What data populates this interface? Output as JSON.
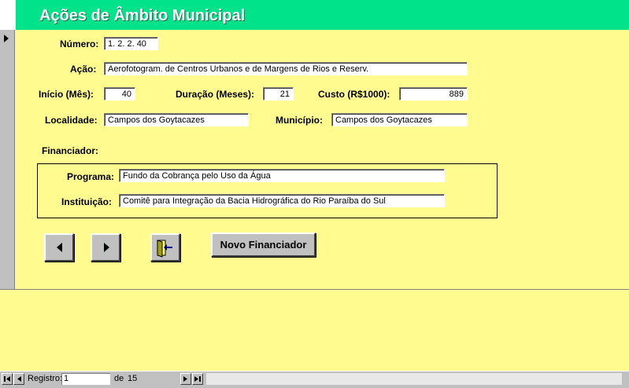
{
  "header": {
    "title": "Ações de Âmbito Municipal"
  },
  "form": {
    "numero": {
      "label": "Número:",
      "value": "1. 2. 2. 40"
    },
    "acao": {
      "label": "Ação:",
      "value": "Aerofotogram. de Centros Urbanos e de Margens de Rios e Reserv."
    },
    "inicio": {
      "label": "Início (Mês):",
      "value": "40"
    },
    "duracao": {
      "label": "Duração (Meses):",
      "value": "21"
    },
    "custo": {
      "label": "Custo (R$1000):",
      "value": "889"
    },
    "localidade": {
      "label": "Localidade:",
      "value": "Campos dos Goytacazes"
    },
    "municipio": {
      "label": "Município:",
      "value": "Campos dos Goytacazes"
    },
    "financiador": {
      "label": "Financiador:"
    },
    "programa": {
      "label": "Programa:",
      "value": "Fundo da Cobrança pelo Uso da Água"
    },
    "instituicao": {
      "label": "Instituição:",
      "value": "Comitê para Integração da Bacia Hidrográfica do Rio Paraíba do Sul"
    }
  },
  "buttons": {
    "prev_icon": "triangle-left-icon",
    "next_icon": "triangle-right-icon",
    "exit_icon": "exit-door-icon",
    "novo_financiador": "Novo Financiador"
  },
  "navigation": {
    "registro_label": "Registro:",
    "current_record": "1",
    "of_label": "de",
    "total_records": "15"
  },
  "colors": {
    "background": "#fffb8e",
    "header": "#00e38a",
    "button": "#c0c0c0"
  }
}
